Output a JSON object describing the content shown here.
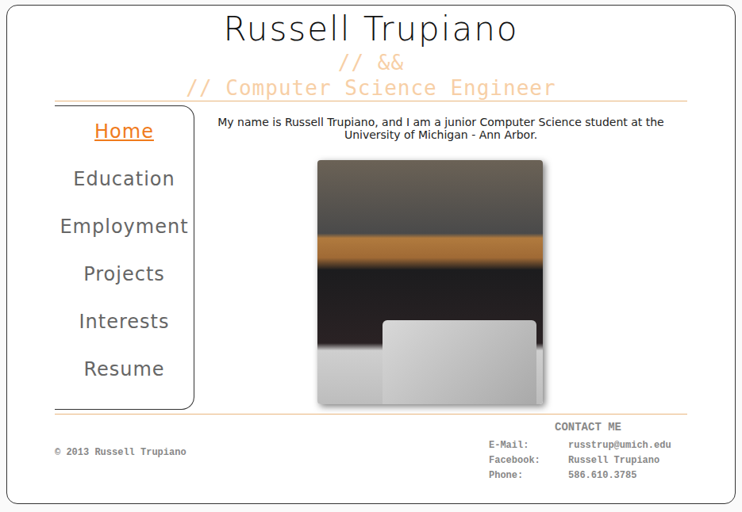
{
  "header": {
    "title": "Russell Trupiano",
    "subtitle_lines": [
      "// &&",
      "// Computer Science Engineer"
    ]
  },
  "nav": {
    "items": [
      {
        "label": "Home",
        "selected": true
      },
      {
        "label": "Education",
        "selected": false
      },
      {
        "label": "Employment",
        "selected": false
      },
      {
        "label": "Projects",
        "selected": false
      },
      {
        "label": "Interests",
        "selected": false
      },
      {
        "label": "Resume",
        "selected": false
      }
    ]
  },
  "intro": "My name is Russell Trupiano, and I am a junior Computer Science student at the University of Michigan - Ann Arbor.",
  "footer": {
    "copyright": "© 2013 Russell Trupiano",
    "contact": {
      "heading": "CONTACT ME",
      "rows": [
        {
          "label": "E-Mail:",
          "value": "russtrup@umich.edu"
        },
        {
          "label": "Facebook:",
          "value": "Russell Trupiano"
        },
        {
          "label": "Phone:",
          "value": "586.610.3785"
        }
      ]
    }
  }
}
